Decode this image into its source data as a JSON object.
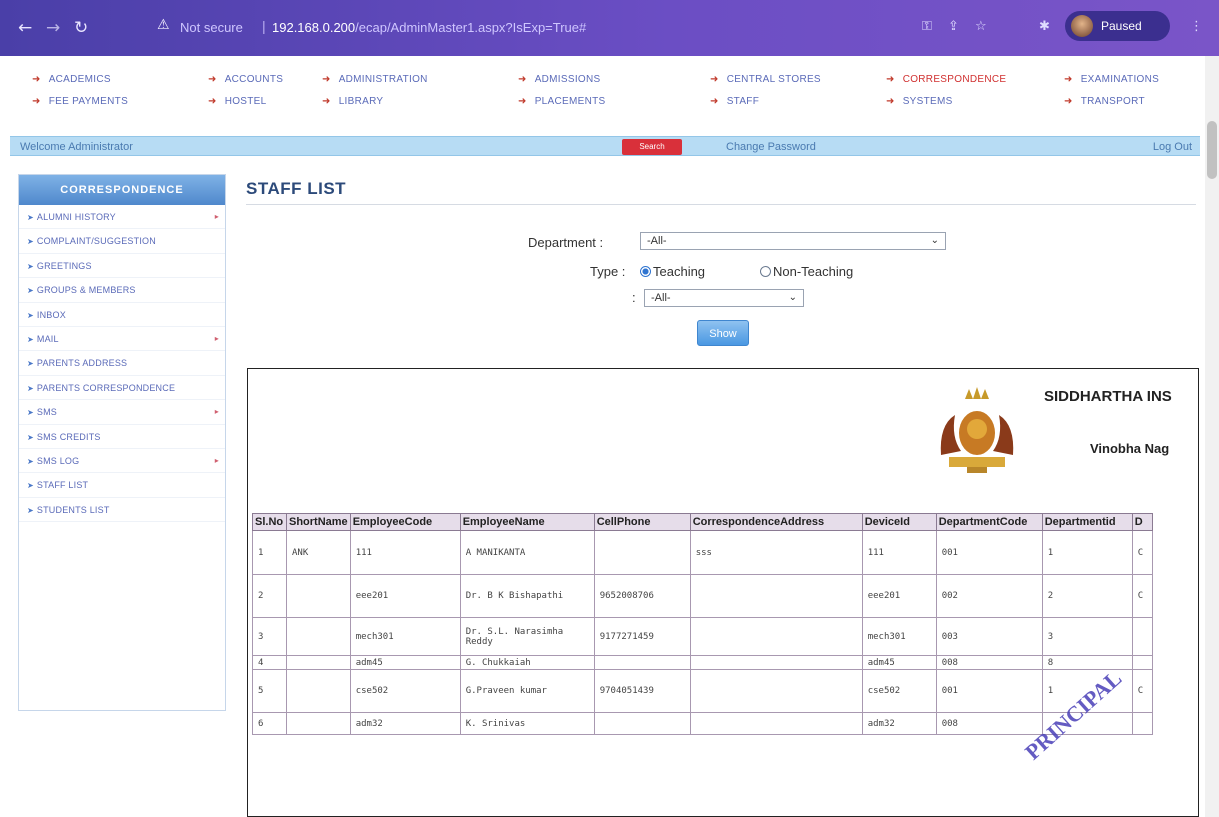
{
  "browser": {
    "not_secure": "Not secure",
    "url_host": "192.168.0.200",
    "url_path": "/ecap/AdminMaster1.aspx?IsExp=True#",
    "profile_label": "Paused"
  },
  "menu": {
    "items": [
      "ACADEMICS",
      "ACCOUNTS",
      "ADMINISTRATION",
      "ADMISSIONS",
      "CENTRAL STORES",
      "CORRESPONDENCE",
      "EXAMINATIONS",
      "FEE PAYMENTS",
      "HOSTEL",
      "LIBRARY",
      "PLACEMENTS",
      "STAFF",
      "SYSTEMS",
      "TRANSPORT"
    ],
    "active": "CORRESPONDENCE"
  },
  "welcome_bar": {
    "welcome": "Welcome Administrator",
    "search": "Search",
    "change_password": "Change Password",
    "logout": "Log Out"
  },
  "sidebar": {
    "title": "CORRESPONDENCE",
    "items": [
      {
        "label": "ALUMNI HISTORY",
        "more": true
      },
      {
        "label": "COMPLAINT/SUGGESTION",
        "more": false
      },
      {
        "label": "GREETINGS",
        "more": false
      },
      {
        "label": "GROUPS & MEMBERS",
        "more": false
      },
      {
        "label": "INBOX",
        "more": false
      },
      {
        "label": "MAIL",
        "more": true
      },
      {
        "label": "PARENTS ADDRESS",
        "more": false
      },
      {
        "label": "PARENTS CORRESPONDENCE",
        "more": false
      },
      {
        "label": "SMS",
        "more": true
      },
      {
        "label": "SMS CREDITS",
        "more": false
      },
      {
        "label": "SMS LOG",
        "more": true
      },
      {
        "label": "STAFF LIST",
        "more": false
      },
      {
        "label": "STUDENTS LIST",
        "more": false
      }
    ]
  },
  "main": {
    "title": "STAFF LIST",
    "department_label": "Department :",
    "department_value": "-All-",
    "type_label": "Type :",
    "type_options": [
      "Teaching",
      "Non-Teaching"
    ],
    "type_selected": "Teaching",
    "second_select_label": ":",
    "second_select_value": "-All-",
    "show_button": "Show"
  },
  "report": {
    "institution_name": "SIDDHARTHA INS",
    "institution_address": "Vinobha Nag",
    "columns": [
      "Sl.No",
      "ShortName",
      "EmployeeCode",
      "EmployeeName",
      "CellPhone",
      "CorrespondenceAddress",
      "DeviceId",
      "DepartmentCode",
      "Departmentid",
      "D"
    ],
    "rows": [
      [
        "1",
        "ANK",
        "111",
        "A MANIKANTA",
        "",
        "sss",
        "111",
        "001",
        "1",
        "C"
      ],
      [
        "2",
        "",
        "eee201",
        "Dr. B K Bishapathi",
        "9652008706",
        "",
        "eee201",
        "002",
        "2",
        "C"
      ],
      [
        "3",
        "",
        "mech301",
        "Dr. S.L. Narasimha Reddy",
        "9177271459",
        "",
        "mech301",
        "003",
        "3",
        ""
      ],
      [
        "4",
        "",
        "adm45",
        "G. Chukkaiah",
        "",
        "",
        "adm45",
        "008",
        "8",
        ""
      ],
      [
        "5",
        "",
        "cse502",
        "G.Praveen kumar",
        "9704051439",
        "",
        "cse502",
        "001",
        "1",
        "C"
      ],
      [
        "6",
        "",
        "adm32",
        "K. Srinivas",
        "",
        "",
        "adm32",
        "008",
        "",
        ""
      ]
    ]
  },
  "stamp": {
    "text": "PRINCIPAL SIDDHARTHA Institute of Science & Technology"
  },
  "colors": {
    "chrome": "#5a46b8",
    "welcome_bar": "#b7dcf4",
    "accent_red": "#d9303a",
    "sidebar_head": "#4f88cc",
    "table_header": "#e6ddea"
  }
}
